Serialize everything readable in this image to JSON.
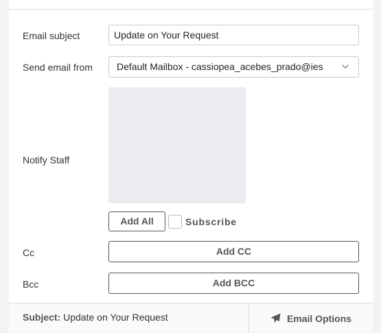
{
  "form": {
    "email_subject_label": "Email subject",
    "email_subject_value": "Update on Your Request",
    "send_from_label": "Send email from",
    "send_from_value": "Default Mailbox - cassiopea_acebes_prado@ies",
    "notify_staff_label": "Notify Staff",
    "add_all_label": "Add All",
    "subscribe_label": "Subscribe",
    "subscribe_checked": false,
    "cc_label": "Cc",
    "add_cc_label": "Add CC",
    "bcc_label": "Bcc",
    "add_bcc_label": "Add BCC"
  },
  "footer": {
    "subject_key": "Subject:",
    "subject_value": "Update on Your Request",
    "email_options_label": "Email Options"
  },
  "icons": {
    "select_chevron": "chevron-down-icon",
    "email_options": "paper-plane-icon"
  },
  "colors": {
    "panel_bg": "#ffffff",
    "page_bg": "#f3f3f3",
    "staff_list_bg": "#eaecf0",
    "button_border": "#555555"
  }
}
